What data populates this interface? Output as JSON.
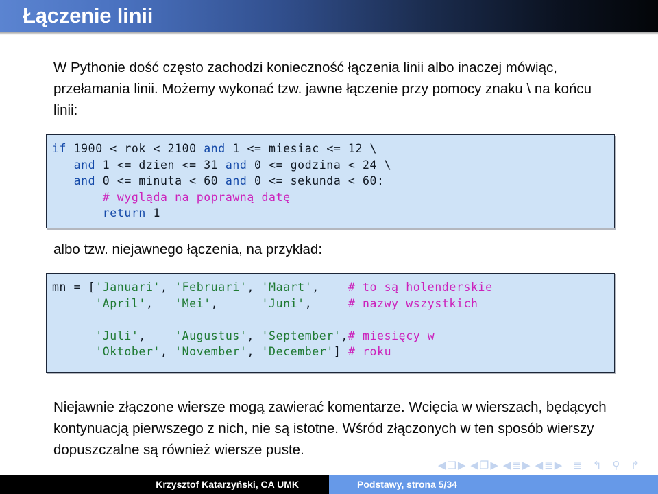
{
  "header": {
    "title": "Łączenie linii"
  },
  "body": {
    "intro_paragraph": "W Pythonie dość często zachodzi konieczność łączenia linii albo inaczej mówiąc, przełamania linii. Możemy wykonać tzw. jawne łączenie przy pomocy znaku \\ na końcu linii:",
    "mid_paragraph": "albo tzw. niejawnego łączenia, na przykład:",
    "outro_paragraph": "Niejawnie złączone wiersze mogą zawierać komentarze. Wcięcia w wierszach, będących kontynuacją pierwszego z nich, nie są istotne. Wśród złączonych w ten sposób wierszy dopuszczalne są również wiersze puste."
  },
  "code_block_1": {
    "language": "python",
    "lines": [
      [
        {
          "t": "if",
          "c": "kw"
        },
        {
          "t": " 1900 < rok < 2100 ",
          "c": "plain"
        },
        {
          "t": "and",
          "c": "kw"
        },
        {
          "t": " 1 <= miesiac <= 12 \\",
          "c": "plain"
        }
      ],
      [
        {
          "t": "   ",
          "c": "plain"
        },
        {
          "t": "and",
          "c": "kw"
        },
        {
          "t": " 1 <= dzien <= 31 ",
          "c": "plain"
        },
        {
          "t": "and",
          "c": "kw"
        },
        {
          "t": " 0 <= godzina < 24 \\",
          "c": "plain"
        }
      ],
      [
        {
          "t": "   ",
          "c": "plain"
        },
        {
          "t": "and",
          "c": "kw"
        },
        {
          "t": " 0 <= minuta < 60 ",
          "c": "plain"
        },
        {
          "t": "and",
          "c": "kw"
        },
        {
          "t": " 0 <= sekunda < 60:",
          "c": "plain"
        }
      ],
      [
        {
          "t": "       ",
          "c": "plain"
        },
        {
          "t": "# wygląda na poprawną datę",
          "c": "cmt"
        }
      ],
      [
        {
          "t": "       ",
          "c": "plain"
        },
        {
          "t": "return",
          "c": "kw"
        },
        {
          "t": " 1",
          "c": "plain"
        }
      ]
    ]
  },
  "code_block_2": {
    "language": "python",
    "lines": [
      [
        {
          "t": "mn = [",
          "c": "plain"
        },
        {
          "t": "'Januari'",
          "c": "str"
        },
        {
          "t": ", ",
          "c": "plain"
        },
        {
          "t": "'Februari'",
          "c": "str"
        },
        {
          "t": ", ",
          "c": "plain"
        },
        {
          "t": "'Maart'",
          "c": "str"
        },
        {
          "t": ",    ",
          "c": "plain"
        },
        {
          "t": "# to są holenderskie",
          "c": "cmt"
        }
      ],
      [
        {
          "t": "      ",
          "c": "plain"
        },
        {
          "t": "'April'",
          "c": "str"
        },
        {
          "t": ",   ",
          "c": "plain"
        },
        {
          "t": "'Mei'",
          "c": "str"
        },
        {
          "t": ",      ",
          "c": "plain"
        },
        {
          "t": "'Juni'",
          "c": "str"
        },
        {
          "t": ",     ",
          "c": "plain"
        },
        {
          "t": "# nazwy wszystkich",
          "c": "cmt"
        }
      ],
      [
        {
          "t": "",
          "c": "plain"
        }
      ],
      [
        {
          "t": "      ",
          "c": "plain"
        },
        {
          "t": "'Juli'",
          "c": "str"
        },
        {
          "t": ",    ",
          "c": "plain"
        },
        {
          "t": "'Augustus'",
          "c": "str"
        },
        {
          "t": ", ",
          "c": "plain"
        },
        {
          "t": "'September'",
          "c": "str"
        },
        {
          "t": ",",
          "c": "plain"
        },
        {
          "t": "# miesięcy w",
          "c": "cmt"
        }
      ],
      [
        {
          "t": "      ",
          "c": "plain"
        },
        {
          "t": "'Oktober'",
          "c": "str"
        },
        {
          "t": ", ",
          "c": "plain"
        },
        {
          "t": "'November'",
          "c": "str"
        },
        {
          "t": ", ",
          "c": "plain"
        },
        {
          "t": "'December'",
          "c": "str"
        },
        {
          "t": "] ",
          "c": "plain"
        },
        {
          "t": "# roku",
          "c": "cmt"
        }
      ]
    ]
  },
  "navigation": {
    "groups": [
      {
        "name": "slide-nav",
        "prev": "◀",
        "glyph": "❑",
        "next": "▶"
      },
      {
        "name": "frame-nav",
        "prev": "◀",
        "glyph": "❐",
        "next": "▶"
      },
      {
        "name": "subsection-nav",
        "prev": "◀",
        "glyph": "≣",
        "next": "▶"
      },
      {
        "name": "section-nav",
        "prev": "◀",
        "glyph": "≣",
        "next": "▶"
      },
      {
        "name": "presentation-nav",
        "glyph": "≣"
      },
      {
        "name": "back-nav",
        "glyph": "↰"
      },
      {
        "name": "search-nav",
        "glyph": "⚲"
      },
      {
        "name": "forward-nav",
        "glyph": "↱"
      }
    ]
  },
  "footer": {
    "author": "Krzysztof Katarzyński, CA UMK",
    "page_label": "Podstawy, strona 5/34"
  }
}
